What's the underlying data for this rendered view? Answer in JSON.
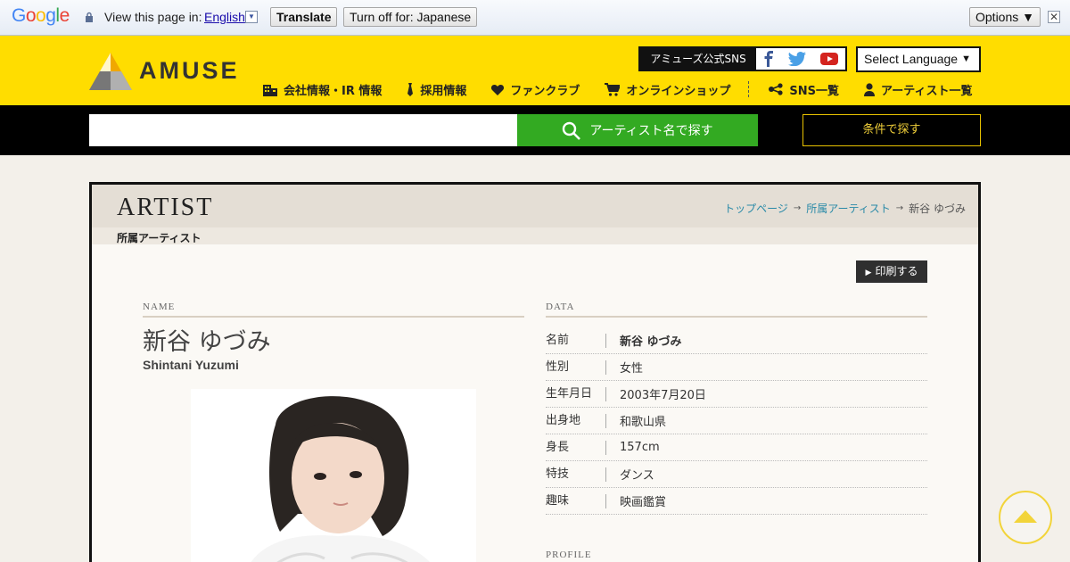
{
  "translate_bar": {
    "logo": "Google",
    "view_label": "View this page in:",
    "language": "English",
    "language_arrow": "▼",
    "translate_button": "Translate",
    "turn_off_button": "Turn off for: Japanese",
    "options_button": "Options ▼",
    "close": "✕"
  },
  "header": {
    "logo_text": "AMUSE",
    "sns_label": "アミューズ公式SNS",
    "sns_icons": [
      "facebook-icon",
      "twitter-icon",
      "youtube-icon"
    ],
    "language_select": "Select Language",
    "language_select_arrow": "▼",
    "nav": [
      {
        "label": "会社情報・IR 情報",
        "icon": "building-icon"
      },
      {
        "label": "採用情報",
        "icon": "tie-icon"
      },
      {
        "label": "ファンクラブ",
        "icon": "heart-icon"
      },
      {
        "label": "オンラインショップ",
        "icon": "cart-icon"
      },
      {
        "label": "SNS一覧",
        "icon": "share-icon"
      },
      {
        "label": "アーティスト一覧",
        "icon": "person-icon"
      }
    ]
  },
  "search": {
    "placeholder": "",
    "button_label": "アーティスト名で探す",
    "condition_button": "条件で探す"
  },
  "panel": {
    "title": "ARTIST",
    "subtitle": "所属アーティスト",
    "breadcrumb": [
      {
        "label": "トップページ",
        "link": true
      },
      {
        "label": "所属アーティスト",
        "link": true
      },
      {
        "label": "新谷 ゆづみ",
        "link": false
      }
    ],
    "breadcrumb_sep": "→",
    "print_button": "印刷する"
  },
  "artist": {
    "name_section": "NAME",
    "name_ja": "新谷 ゆづみ",
    "name_en": "Shintani Yuzumi",
    "data_section": "DATA",
    "data": [
      {
        "key": "名前",
        "value": "新谷 ゆづみ",
        "bold": true
      },
      {
        "key": "性別",
        "value": "女性"
      },
      {
        "key": "生年月日",
        "value": "2003年7月20日"
      },
      {
        "key": "出身地",
        "value": "和歌山県"
      },
      {
        "key": "身長",
        "value": "157cm"
      },
      {
        "key": "特技",
        "value": "ダンス"
      },
      {
        "key": "趣味",
        "value": "映画鑑賞"
      }
    ],
    "profile_section": "PROFILE"
  },
  "colors": {
    "header_yellow": "#ffdd00",
    "search_green": "#33aa22",
    "link_teal": "#2a8aa8"
  }
}
